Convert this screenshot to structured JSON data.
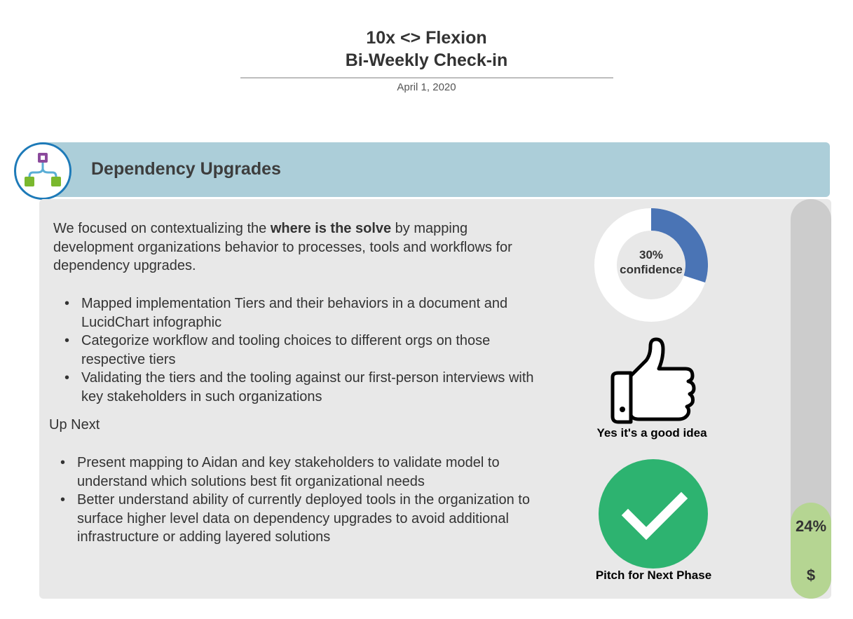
{
  "header": {
    "title_line1": "10x <> Flexion",
    "title_line2": "Bi-Weekly Check-in",
    "date": "April 1, 2020"
  },
  "section": {
    "title": "Dependency Upgrades",
    "icon": "hierarchy-icon",
    "bar_color": "#acced9"
  },
  "intro": {
    "before": "We focused on contextualizing the ",
    "bold": "where is the solve",
    "after": " by mapping development organizations behavior to processes, tools and workflows for dependency upgrades."
  },
  "done_items": [
    "Mapped implementation Tiers and their behaviors in a document and LucidChart infographic",
    "Categorize workflow and tooling choices to different orgs on those respective tiers",
    "Validating the tiers and the tooling against our first-person interviews with key stakeholders in such organizations"
  ],
  "up_next": {
    "heading": "Up Next",
    "items": [
      "Present mapping to Aidan and key stakeholders to validate model to understand which solutions best fit organizational needs",
      "Better understand ability of currently deployed tools in the organization to surface higher level data on dependency upgrades to avoid additional infrastructure or adding layered solutions"
    ]
  },
  "confidence": {
    "value": 30,
    "percent_text": "30%",
    "label": "confidence",
    "color": "#4a74b5"
  },
  "thumb": {
    "icon": "thumbs-up-icon",
    "label": "Yes it's a good idea"
  },
  "pitch": {
    "icon": "check-icon",
    "label": "Pitch for Next Phase",
    "color": "#2db370"
  },
  "budget": {
    "value": 24,
    "percent_text": "24%",
    "symbol": "$",
    "fill_color": "#b5d592"
  }
}
